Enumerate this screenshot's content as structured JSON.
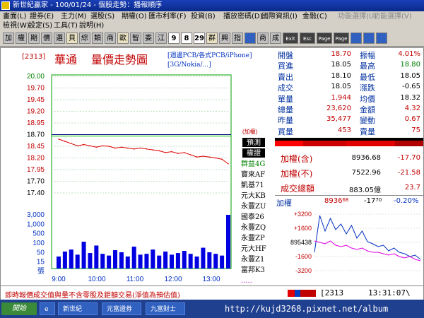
{
  "window": {
    "title": "新世紀贏家 - 100/01/24 - 個股走勢：播報順序"
  },
  "menu": [
    "畫面(L)",
    "證券(E)",
    "主力(M)",
    "選股(S)",
    "期權(O)",
    "匯市利率(F)",
    "投資(B)",
    "播放密碼(D)",
    "國際資訊(I)",
    "金融(C)",
    "功能選擇(U)",
    "功能選擇(V)",
    "檢視(W)",
    "設定(S)",
    "工具(T)",
    "說明(H)"
  ],
  "toolbar": [
    "加",
    "權",
    "期",
    "價",
    "選",
    "貝",
    "綜",
    "類",
    "商",
    "歐",
    "智",
    "委",
    "江",
    "9",
    "8",
    "29",
    "群",
    "興",
    "指",
    "",
    "商",
    "成",
    "Exit",
    "Esc",
    "Page Up",
    "Page Down",
    "",
    "",
    ""
  ],
  "stock": {
    "code": "[2313]",
    "name": "華通",
    "title": "量價走勢圖",
    "concept_line1": "[週邊PCB/各式PCB/iPhone]",
    "concept_line2": "[3G/Nokia/...]"
  },
  "price_axis": [
    "20.00",
    "19.70",
    "19.45",
    "19.20",
    "18.95",
    "18.70",
    "18.45",
    "18.20",
    "17.95",
    "17.70",
    "17.40"
  ],
  "volume_axis": [
    "3,000",
    "1,000",
    "500",
    "100",
    "50",
    "15",
    "張"
  ],
  "time_axis": [
    "9:00",
    "10:00",
    "11:00",
    "12:00",
    "13:00"
  ],
  "chart_labels": {
    "add_right": "(加權)",
    "forecast": "預測",
    "rights": "權證"
  },
  "warrants": [
    "群益4G",
    "寶來AF",
    "凱基71",
    "元大KB",
    "永豐ZU",
    "國泰26",
    "永豐ZQ",
    "永豐ZP",
    "元大HF",
    "永豐Z1",
    "富邦K3",
    "....."
  ],
  "chart_data": {
    "type": "line",
    "title": "量價走勢圖",
    "x": [
      "9:00",
      "9:10",
      "9:20",
      "9:30",
      "9:40",
      "9:50",
      "10:00",
      "10:10",
      "10:20",
      "10:30",
      "10:40",
      "10:50",
      "11:00",
      "11:10",
      "11:20",
      "11:30",
      "11:40",
      "11:50",
      "12:00",
      "12:10",
      "12:20",
      "12:30",
      "12:40",
      "12:50",
      "13:00",
      "13:10",
      "13:20",
      "13:30"
    ],
    "series": [
      {
        "values": [
          18.6,
          18.55,
          18.5,
          18.45,
          18.48,
          18.45,
          18.42,
          18.45,
          18.44,
          18.4,
          18.42,
          18.4,
          18.38,
          18.4,
          18.38,
          18.36,
          18.34,
          18.3,
          18.32,
          18.28,
          18.3,
          18.25,
          18.2,
          18.22,
          18.2,
          18.18,
          18.15,
          18.05
        ]
      }
    ],
    "reference": 18.7,
    "ylim": [
      17.4,
      20.0
    ],
    "volume": [
      60,
      120,
      150,
      80,
      300,
      100,
      220,
      90,
      70,
      140,
      110,
      60,
      200,
      80,
      90,
      150,
      70,
      120,
      80,
      100,
      130,
      90,
      60,
      180,
      110,
      90,
      70,
      1200
    ]
  },
  "quote": {
    "rows": [
      {
        "l1": "開盤",
        "v1": "18.70",
        "l2": "振幅",
        "v2": "4.01%",
        "c1": "red",
        "c2": "red"
      },
      {
        "l1": "買進",
        "v1": "18.05",
        "l2": "最高",
        "v2": "18.80",
        "c1": "blk",
        "c2": "grn"
      },
      {
        "l1": "賣出",
        "v1": "18.10",
        "l2": "最低",
        "v2": "18.05",
        "c1": "blk",
        "c2": "blk"
      },
      {
        "l1": "成交",
        "v1": "18.05",
        "l2": "漲跌",
        "v2": "-0.65",
        "c1": "blk",
        "c2": "blk"
      },
      {
        "l1": "單量",
        "v1": "1,944",
        "l2": "均價",
        "v2": "18.32",
        "c1": "red",
        "c2": "blk"
      },
      {
        "l1": "總量",
        "v1": "23,620",
        "l2": "金額",
        "v2": "4.32",
        "c1": "red",
        "c2": "red"
      },
      {
        "l1": "昨量",
        "v1": "35,477",
        "l2": "變動",
        "v2": "0.67",
        "c1": "red",
        "c2": "red"
      },
      {
        "l1": "買量",
        "v1": "453",
        "l2": "賣量",
        "v2": "75",
        "c1": "red",
        "c2": "red"
      }
    ]
  },
  "index": {
    "rows": [
      {
        "label": "加權(含)",
        "value": "8936.68",
        "change": "-17.70"
      },
      {
        "label": "加權(不)",
        "value": "7522.96",
        "change": "-21.58"
      },
      {
        "label": "成交總額",
        "value": "883.05億",
        "change": "23.7"
      }
    ]
  },
  "mini": {
    "label": "加權",
    "value": "8936",
    "value_decimals": "68",
    "change": "-17",
    "change_decimals": "70",
    "pct": "-0.20%",
    "axis": [
      "+3200",
      "+1600",
      "895438",
      "-1600",
      "-3200"
    ]
  },
  "status": {
    "message": "即時報價成交值與量不含零股及鉅額交易(淨值為預估值)",
    "code": "[2313",
    "time": "13:31:07\\"
  },
  "taskbar": {
    "start": "開始",
    "items": [
      "e",
      "新世紀",
      "元富證券",
      "九富財士"
    ],
    "watermark": "http://kujd3268.pixnet.net/album"
  }
}
